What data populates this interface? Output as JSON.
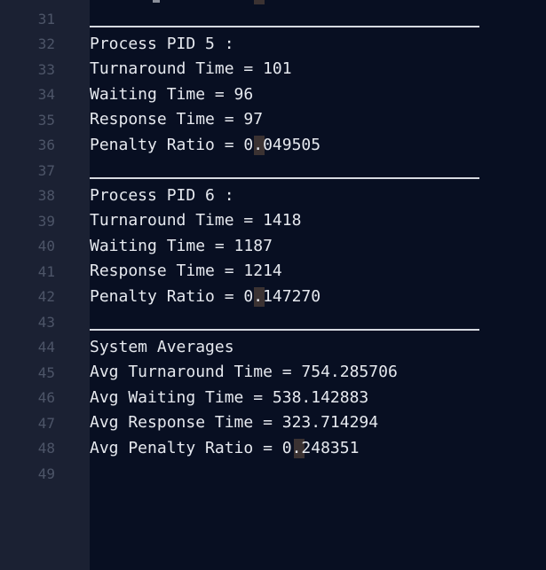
{
  "gutter": {
    "line_numbers": [
      "31",
      "32",
      "33",
      "34",
      "35",
      "36",
      "37",
      "38",
      "39",
      "40",
      "41",
      "42",
      "43",
      "44",
      "45",
      "46",
      "47",
      "48",
      "49"
    ]
  },
  "code": {
    "pid5": {
      "header": "Process PID 5 :",
      "turnaround": "Turnaround Time = 101",
      "waiting": "Waiting Time = 96",
      "response": "Response Time = 97",
      "penalty": "Penalty Ratio = 0.049505"
    },
    "pid6": {
      "header": "Process PID 6 :",
      "turnaround": "Turnaround Time = 1418",
      "waiting": "Waiting Time = 1187",
      "response": "Response Time = 1214",
      "penalty": "Penalty Ratio = 0.147270"
    },
    "averages": {
      "header": "System Averages",
      "turnaround": "Avg Turnaround Time = 754.285706",
      "waiting": "Avg Waiting Time = 538.142883",
      "response": "Avg Response Time = 323.714294",
      "penalty": "Avg Penalty Ratio = 0.248351"
    }
  }
}
